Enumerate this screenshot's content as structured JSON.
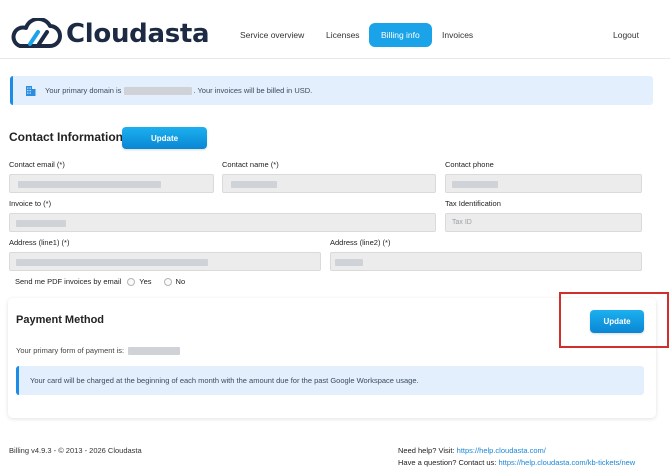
{
  "brand": {
    "name": "Cloudasta",
    "navy": "#1d2a44",
    "accent": "#1aa3e8"
  },
  "nav": {
    "items": [
      {
        "label": "Service overview",
        "active": false
      },
      {
        "label": "Licenses",
        "active": false
      },
      {
        "label": "Billing info",
        "active": true
      },
      {
        "label": "Invoices",
        "active": false
      }
    ],
    "logout": "Logout"
  },
  "domain_alert": {
    "icon": "building-icon",
    "prefix": "Your primary domain is",
    "suffix": ". Your invoices will be billed in USD."
  },
  "contact": {
    "title": "Contact Information",
    "update_label": "Update",
    "fields": {
      "email": {
        "label": "Contact email (*)",
        "value": ""
      },
      "name": {
        "label": "Contact name (*)",
        "value": ""
      },
      "phone": {
        "label": "Contact phone",
        "value": ""
      },
      "invoice_to": {
        "label": "Invoice to (*)",
        "value": ""
      },
      "tax_id": {
        "label": "Tax Identification",
        "placeholder": "Tax ID",
        "value": ""
      },
      "address1": {
        "label": "Address (line1) (*)",
        "value": ""
      },
      "address2": {
        "label": "Address (line2) (*)",
        "value": ""
      }
    },
    "pdf_invoices": {
      "label": "Send me PDF invoices by email",
      "options": [
        "Yes",
        "No"
      ],
      "selected": null
    }
  },
  "payment": {
    "title": "Payment Method",
    "update_label": "Update",
    "primary_text": "Your primary form of payment is:",
    "notice": "Your card will be charged at the beginning of each month with the amount due for the past Google Workspace usage."
  },
  "footer": {
    "version": "Billing v4.9.3 - © 2013 - 2026 Cloudasta",
    "help_prefix": "Need help? Visit: ",
    "help_link": "https://help.cloudasta.com/",
    "question_prefix": "Have a question? Contact us: ",
    "question_link": "https://help.cloudasta.com/kb-tickets/new"
  }
}
